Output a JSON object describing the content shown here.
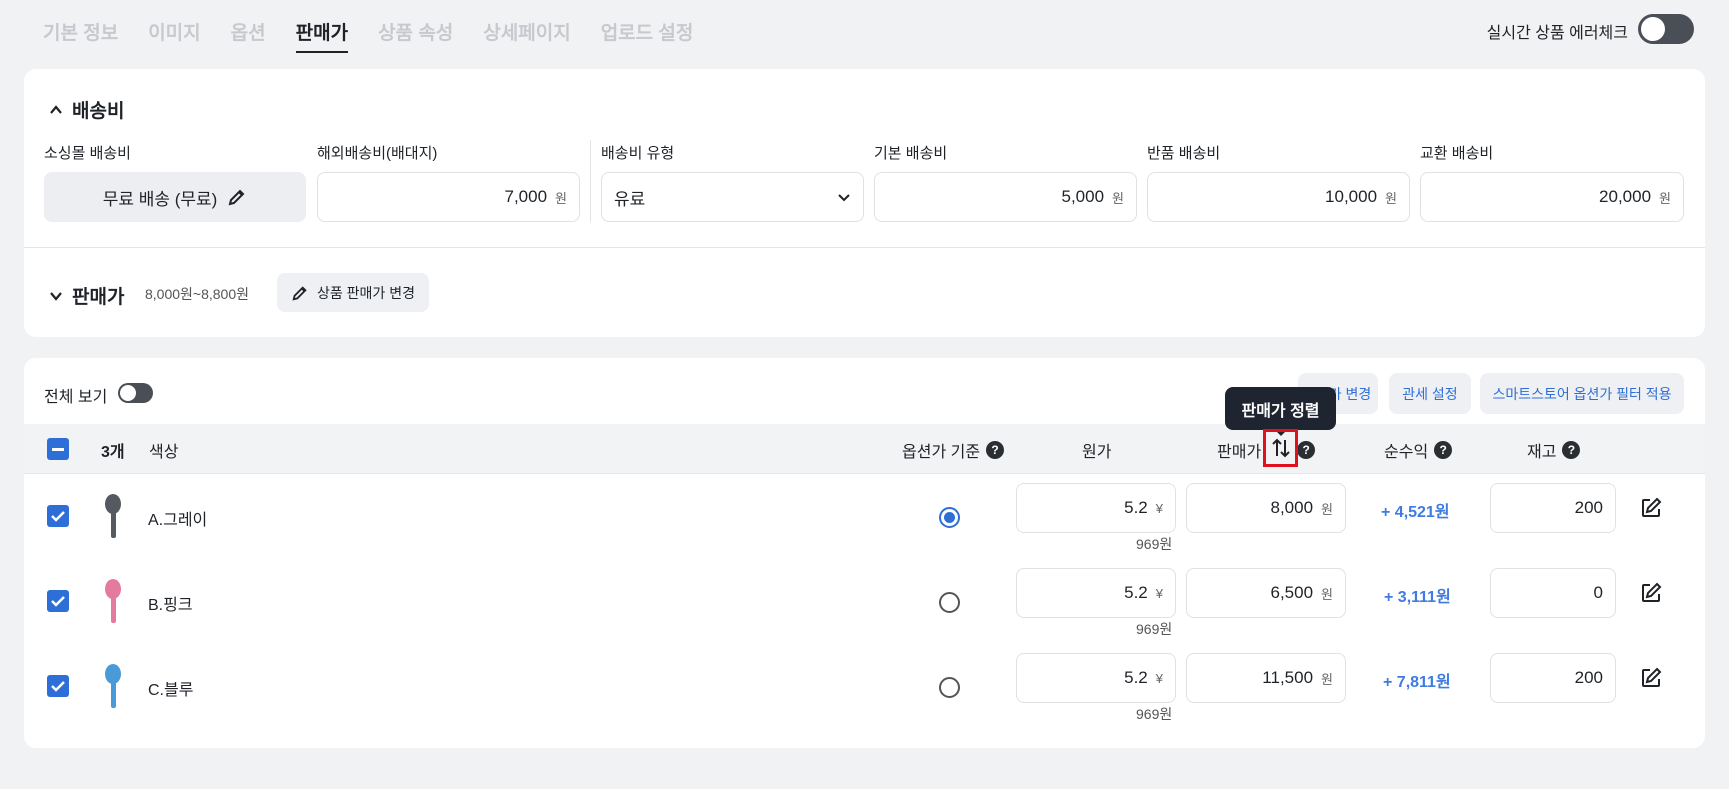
{
  "tabs": [
    {
      "label": "기본 정보"
    },
    {
      "label": "이미지"
    },
    {
      "label": "옵션"
    },
    {
      "label": "판매가"
    },
    {
      "label": "상품 속성"
    },
    {
      "label": "상세페이지"
    },
    {
      "label": "업로드 설정"
    }
  ],
  "active_tab": "판매가",
  "error_check": {
    "label": "실시간 상품 에러체크",
    "on": false
  },
  "shipping": {
    "title": "배송비",
    "fields": {
      "sourcing": {
        "label": "소싱몰 배송비",
        "value": "무료 배송 (무료)"
      },
      "overseas": {
        "label": "해외배송비(배대지)",
        "value": "7,000",
        "unit": "원"
      },
      "type": {
        "label": "배송비 유형",
        "value": "유료"
      },
      "basic": {
        "label": "기본 배송비",
        "value": "5,000",
        "unit": "원"
      },
      "return": {
        "label": "반품 배송비",
        "value": "10,000",
        "unit": "원"
      },
      "exchange": {
        "label": "교환 배송비",
        "value": "20,000",
        "unit": "원"
      }
    }
  },
  "price": {
    "title": "판매가",
    "range": "8,000원~8,800원",
    "change_button": "상품 판매가 변경"
  },
  "options": {
    "view_all_label": "전체 보기",
    "view_all_on": false,
    "buttons": {
      "price_change": "가 변경",
      "tariff": "관세 설정",
      "smartstore_filter": "스마트스토어 옵션가 필터 적용"
    },
    "header": {
      "count": "3개",
      "color": "색상",
      "option_base": "옵션가 기준",
      "cost": "원가",
      "sale_price": "판매가",
      "net_profit": "순수익",
      "stock": "재고"
    },
    "tooltip": "판매가 정렬",
    "rows": [
      {
        "name": "A.그레이",
        "selected": true,
        "cost": "5.2",
        "cost_unit": "¥",
        "cost_krw": "969원",
        "price": "8,000",
        "price_unit": "원",
        "profit": "+ 4,521원",
        "stock": "200",
        "color": "#555a60"
      },
      {
        "name": "B.핑크",
        "selected": false,
        "cost": "5.2",
        "cost_unit": "¥",
        "cost_krw": "969원",
        "price": "6,500",
        "price_unit": "원",
        "profit": "+ 3,111원",
        "stock": "0",
        "color": "#e47aa0"
      },
      {
        "name": "C.블루",
        "selected": false,
        "cost": "5.2",
        "cost_unit": "¥",
        "cost_krw": "969원",
        "price": "11,500",
        "price_unit": "원",
        "profit": "+ 7,811원",
        "stock": "200",
        "color": "#4a9ad8"
      }
    ]
  },
  "colors": {
    "accent": "#2d6fd6",
    "profit": "#3f7be0",
    "highlight": "#e0101e"
  }
}
